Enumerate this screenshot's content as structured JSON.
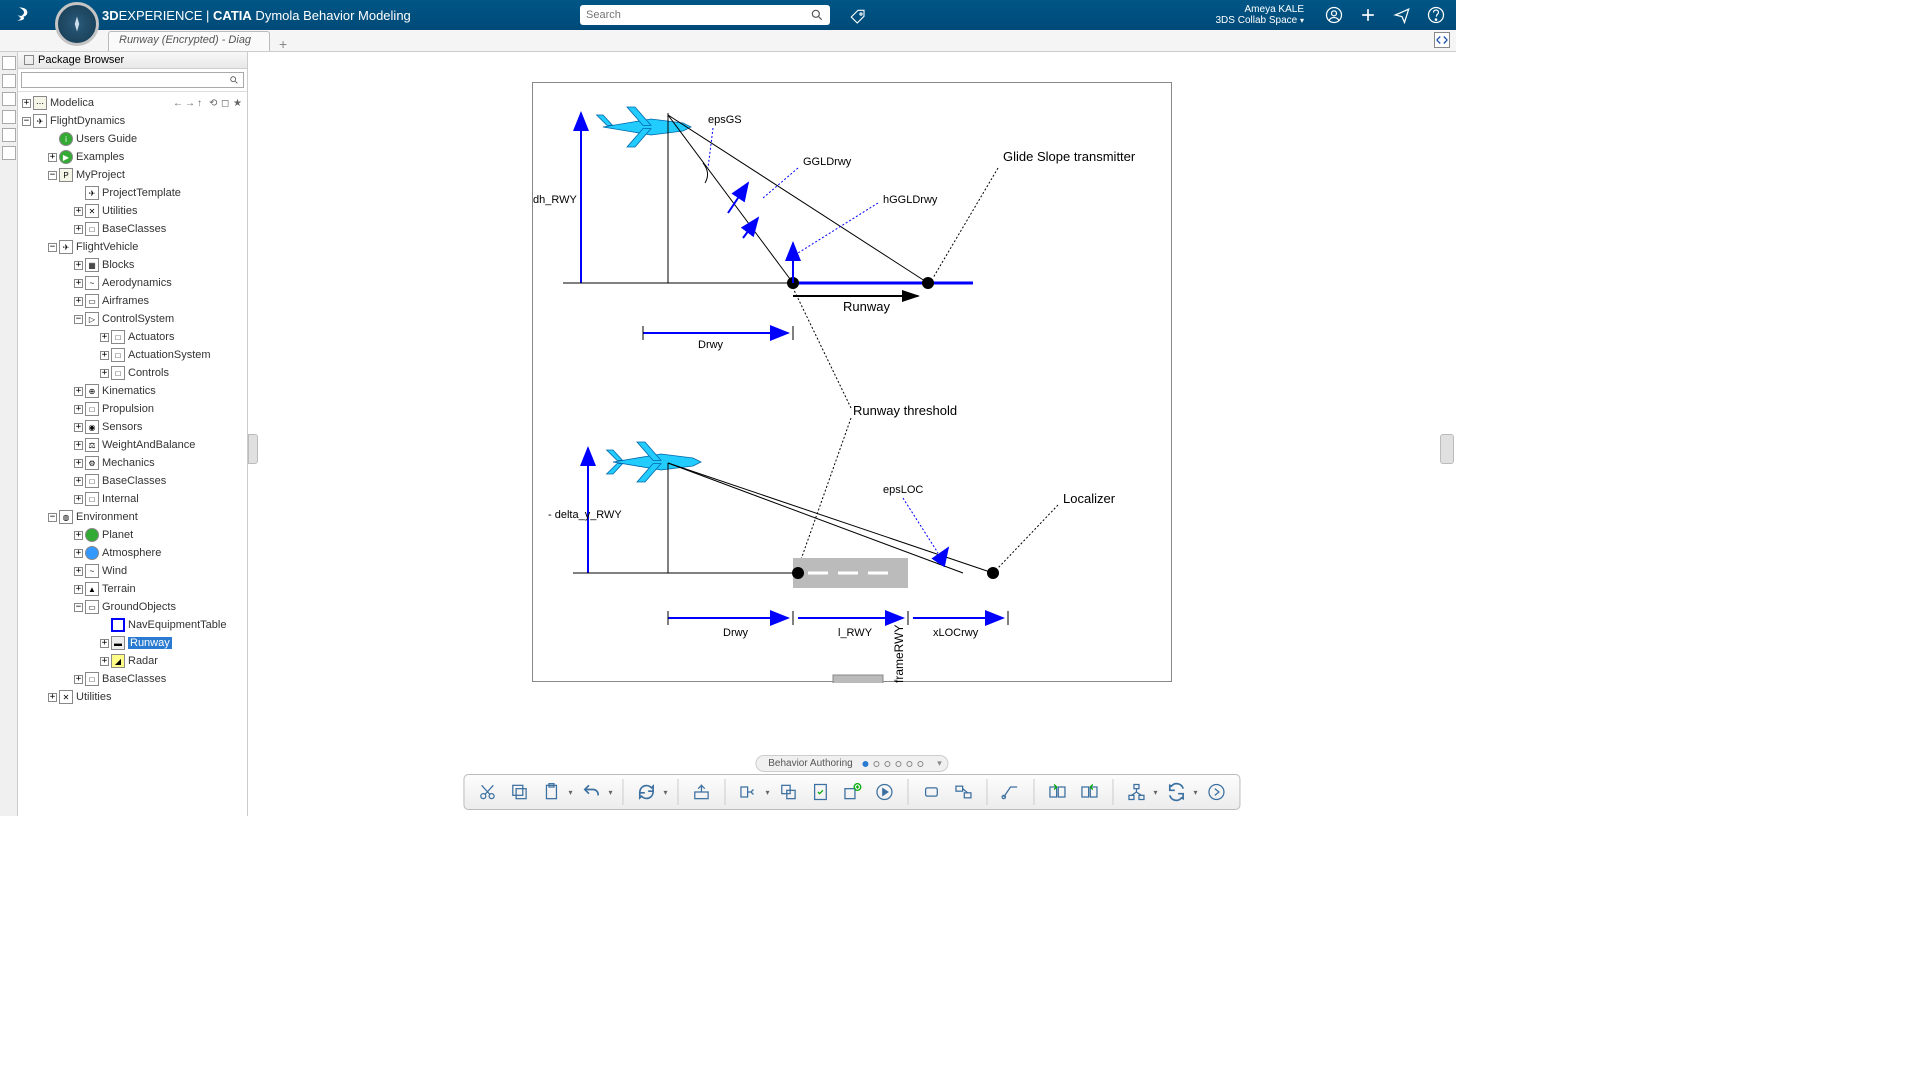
{
  "header": {
    "brand_prefix": "3D",
    "brand_main": "EXPERIENCE",
    "brand_sep": " | ",
    "brand_product": "CATIA",
    "brand_sub": " Dymola Behavior Modeling",
    "search_placeholder": "Search",
    "user_name": "Ameya KALE",
    "user_space": "3DS Collab Space"
  },
  "tab": {
    "title": "Runway (Encrypted) - Diag"
  },
  "package_browser": {
    "title": "Package Browser"
  },
  "tree": {
    "modelica": "Modelica",
    "flightdynamics": "FlightDynamics",
    "usersguide": "Users Guide",
    "examples": "Examples",
    "myproject": "MyProject",
    "projecttemplate": "ProjectTemplate",
    "utilities": "Utilities",
    "baseclasses": "BaseClasses",
    "flightvehicle": "FlightVehicle",
    "blocks": "Blocks",
    "aerodynamics": "Aerodynamics",
    "airframes": "Airframes",
    "controlsystem": "ControlSystem",
    "actuators": "Actuators",
    "actuationsystem": "ActuationSystem",
    "controls": "Controls",
    "kinematics": "Kinematics",
    "propulsion": "Propulsion",
    "sensors": "Sensors",
    "weightandbalance": "WeightAndBalance",
    "mechanics": "Mechanics",
    "baseclasses2": "BaseClasses",
    "internal": "Internal",
    "environment": "Environment",
    "planet": "Planet",
    "atmosphere": "Atmosphere",
    "wind": "Wind",
    "terrain": "Terrain",
    "groundobjects": "GroundObjects",
    "navequipmenttable": "NavEquipmentTable",
    "runway": "Runway",
    "radar": "Radar",
    "baseclasses3": "BaseClasses",
    "utilities2": "Utilities"
  },
  "diagram": {
    "epsGS": "epsGS",
    "GGLDrwy": "GGLDrwy",
    "hGGLDrwy": "hGGLDrwy",
    "dh_RWY": "dh_RWY",
    "glide_slope": "Glide Slope\ntransmitter",
    "runway": "Runway",
    "Drwy": "Drwy",
    "runway_threshold": "Runway threshold",
    "delta_y": "- delta_y_RWY",
    "epsLOC": "epsLOC",
    "localizer": "Localizer",
    "l_RWY": "l_RWY",
    "xLOCrwy": "xLOCrwy",
    "frameRWY": "frameRWY"
  },
  "pager": {
    "label": "Behavior Authoring"
  }
}
